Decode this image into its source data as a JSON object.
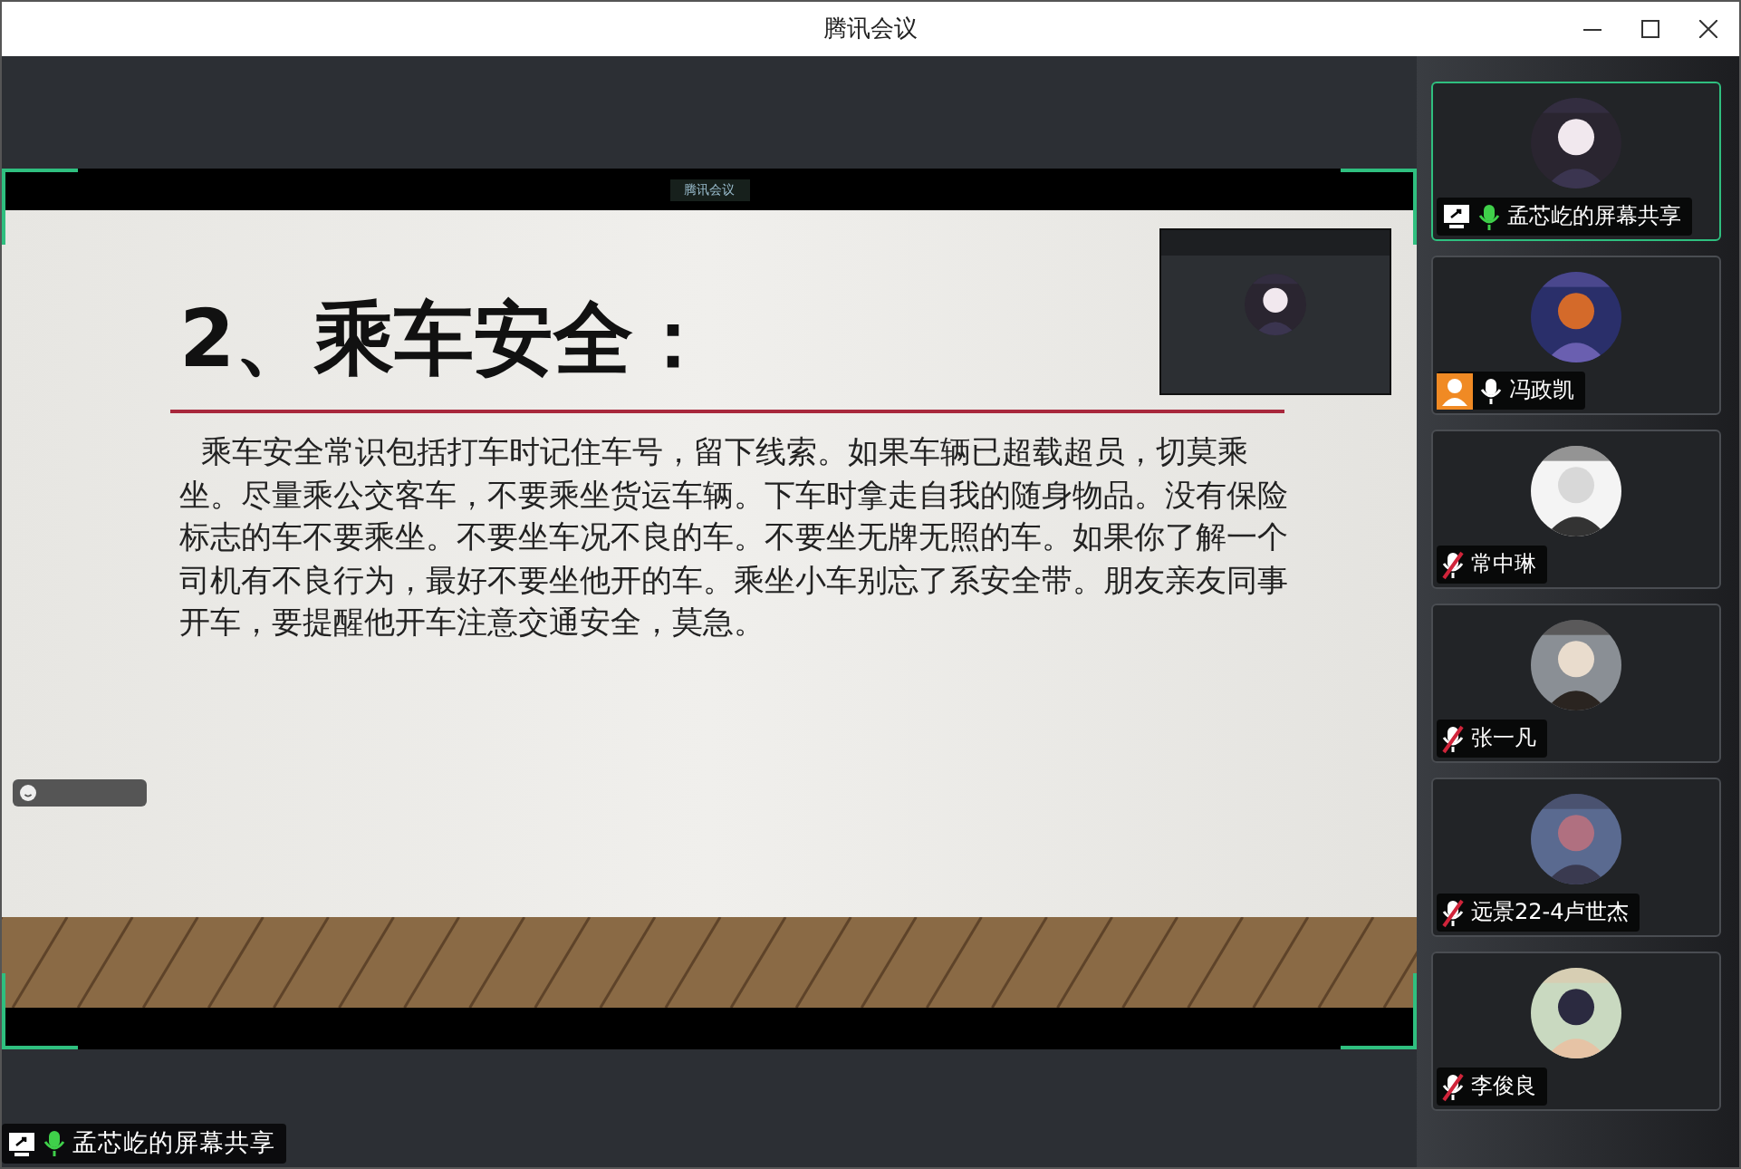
{
  "window": {
    "title": "腾讯会议"
  },
  "shared_screen": {
    "app_badge": "腾讯会议",
    "slide": {
      "title": "2、乘车安全：",
      "body": "乘车安全常识包括打车时记住车号，留下线索。如果车辆已超载超员，切莫乘坐。尽量乘公交客车，不要乘坐货运车辆。下车时拿走自我的随身物品。没有保险标志的车不要乘坐。不要坐车况不良的车。不要坐无牌无照的车。如果你了解一个司机有不良行为，最好不要坐他开的车。乘坐小车别忘了系安全带。朋友亲友同事开车，要提醒他开车注意交通安全，莫急。"
    }
  },
  "presenter_label": {
    "name": "孟芯屹的屏幕共享",
    "muted": false,
    "speaking": true,
    "sharing": true
  },
  "participants": [
    {
      "name": "孟芯屹的屏幕共享",
      "muted": false,
      "speaking": true,
      "sharing": true,
      "host": false,
      "selected": true
    },
    {
      "name": "冯政凯",
      "muted": false,
      "speaking": false,
      "sharing": false,
      "host": true,
      "selected": false
    },
    {
      "name": "常中琳",
      "muted": true,
      "speaking": false,
      "sharing": false,
      "host": false,
      "selected": false
    },
    {
      "name": "张一凡",
      "muted": true,
      "speaking": false,
      "sharing": false,
      "host": false,
      "selected": false
    },
    {
      "name": "远景22-4卢世杰",
      "muted": true,
      "speaking": false,
      "sharing": false,
      "host": false,
      "selected": false
    },
    {
      "name": "李俊良",
      "muted": true,
      "speaking": false,
      "sharing": false,
      "host": false,
      "selected": false
    }
  ]
}
